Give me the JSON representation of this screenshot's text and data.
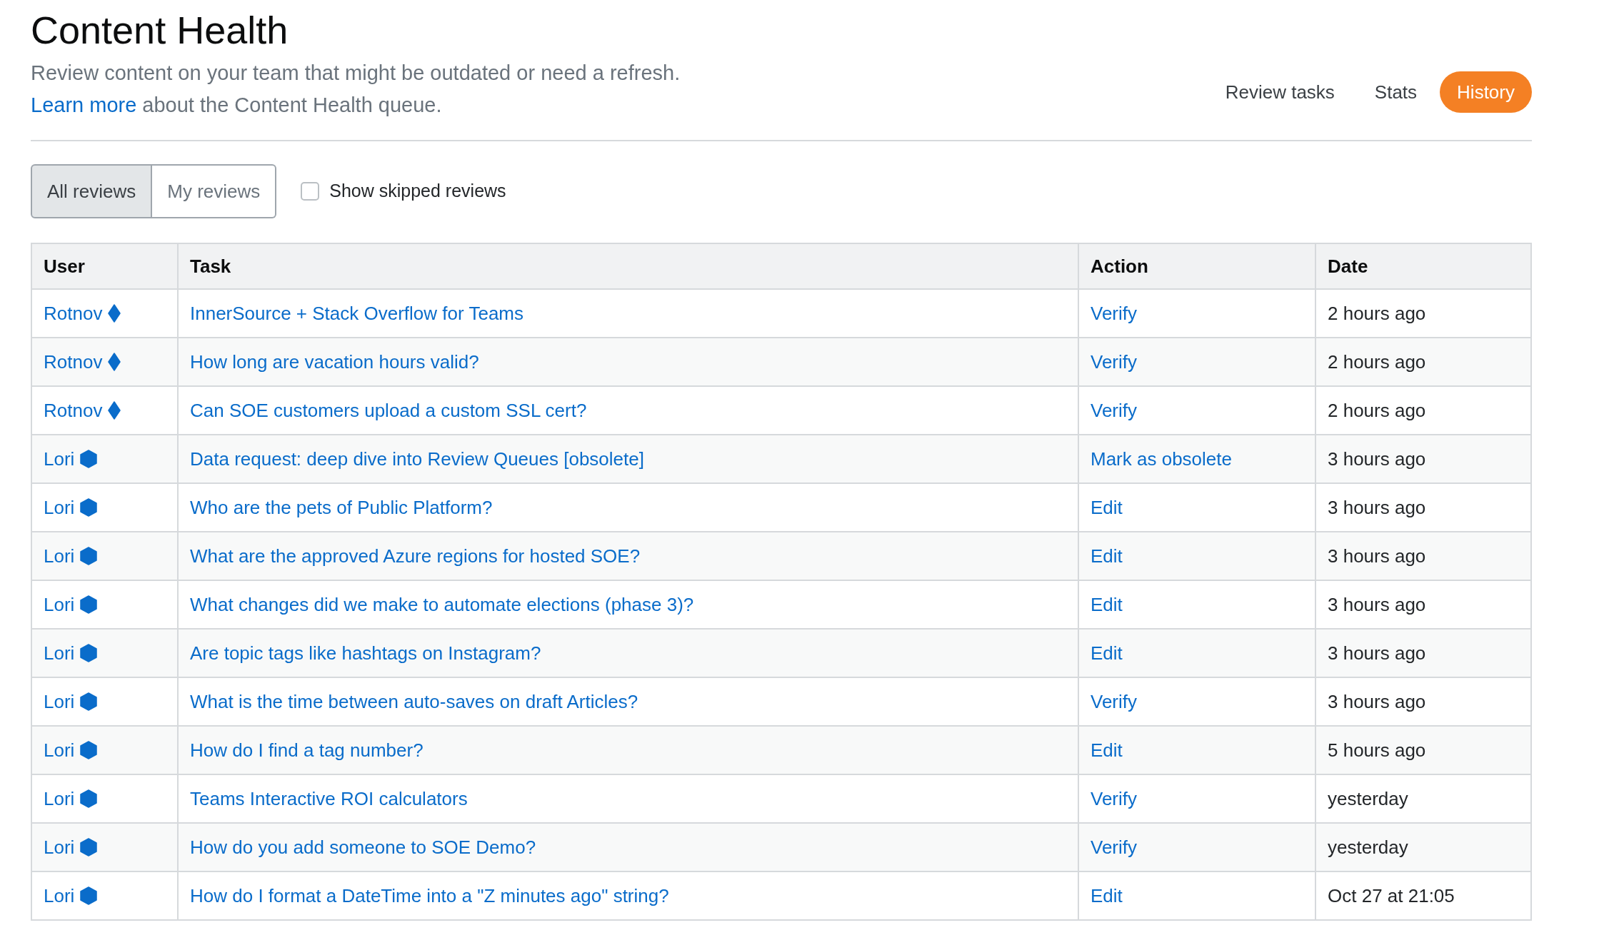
{
  "header": {
    "title": "Content Health",
    "description": "Review content on your team that might be outdated or need a refresh.",
    "learn_more_link": "Learn more",
    "learn_more_rest": "about the Content Health queue."
  },
  "nav_tabs": [
    {
      "label": "Review tasks",
      "selected": false
    },
    {
      "label": "Stats",
      "selected": false
    },
    {
      "label": "History",
      "selected": true
    }
  ],
  "filters": {
    "segments": [
      {
        "label": "All reviews",
        "selected": true
      },
      {
        "label": "My reviews",
        "selected": false
      }
    ],
    "show_skipped": {
      "label": "Show skipped reviews",
      "checked": false
    }
  },
  "table": {
    "columns": [
      "User",
      "Task",
      "Action",
      "Date"
    ],
    "rows": [
      {
        "user": "Rotnov",
        "kind": "diamond",
        "task": "InnerSource + Stack Overflow for Teams",
        "action": "Verify",
        "date": "2 hours ago"
      },
      {
        "user": "Rotnov",
        "kind": "diamond",
        "task": "How long are vacation hours valid?",
        "action": "Verify",
        "date": "2 hours ago"
      },
      {
        "user": "Rotnov",
        "kind": "diamond",
        "task": "Can SOE customers upload a custom SSL cert?",
        "action": "Verify",
        "date": "2 hours ago"
      },
      {
        "user": "Lori",
        "kind": "hexagon",
        "task": "Data request: deep dive into Review Queues [obsolete]",
        "action": "Mark as obsolete",
        "date": "3 hours ago"
      },
      {
        "user": "Lori",
        "kind": "hexagon",
        "task": "Who are the pets of Public Platform?",
        "action": "Edit",
        "date": "3 hours ago"
      },
      {
        "user": "Lori",
        "kind": "hexagon",
        "task": "What are the approved Azure regions for hosted SOE?",
        "action": "Edit",
        "date": "3 hours ago"
      },
      {
        "user": "Lori",
        "kind": "hexagon",
        "task": "What changes did we make to automate elections (phase 3)?",
        "action": "Edit",
        "date": "3 hours ago"
      },
      {
        "user": "Lori",
        "kind": "hexagon",
        "task": "Are topic tags like hashtags on Instagram?",
        "action": "Edit",
        "date": "3 hours ago"
      },
      {
        "user": "Lori",
        "kind": "hexagon",
        "task": "What is the time between auto-saves on draft Articles?",
        "action": "Verify",
        "date": "3 hours ago"
      },
      {
        "user": "Lori",
        "kind": "hexagon",
        "task": "How do I find a tag number?",
        "action": "Edit",
        "date": "5 hours ago"
      },
      {
        "user": "Lori",
        "kind": "hexagon",
        "task": "Teams Interactive ROI calculators",
        "action": "Verify",
        "date": "yesterday"
      },
      {
        "user": "Lori",
        "kind": "hexagon",
        "task": "How do you add someone to SOE Demo?",
        "action": "Verify",
        "date": "yesterday"
      },
      {
        "user": "Lori",
        "kind": "hexagon",
        "task": "How do I format a DateTime into a \"Z minutes ago\" string?",
        "action": "Edit",
        "date": "Oct 27 at 21:05"
      }
    ]
  }
}
